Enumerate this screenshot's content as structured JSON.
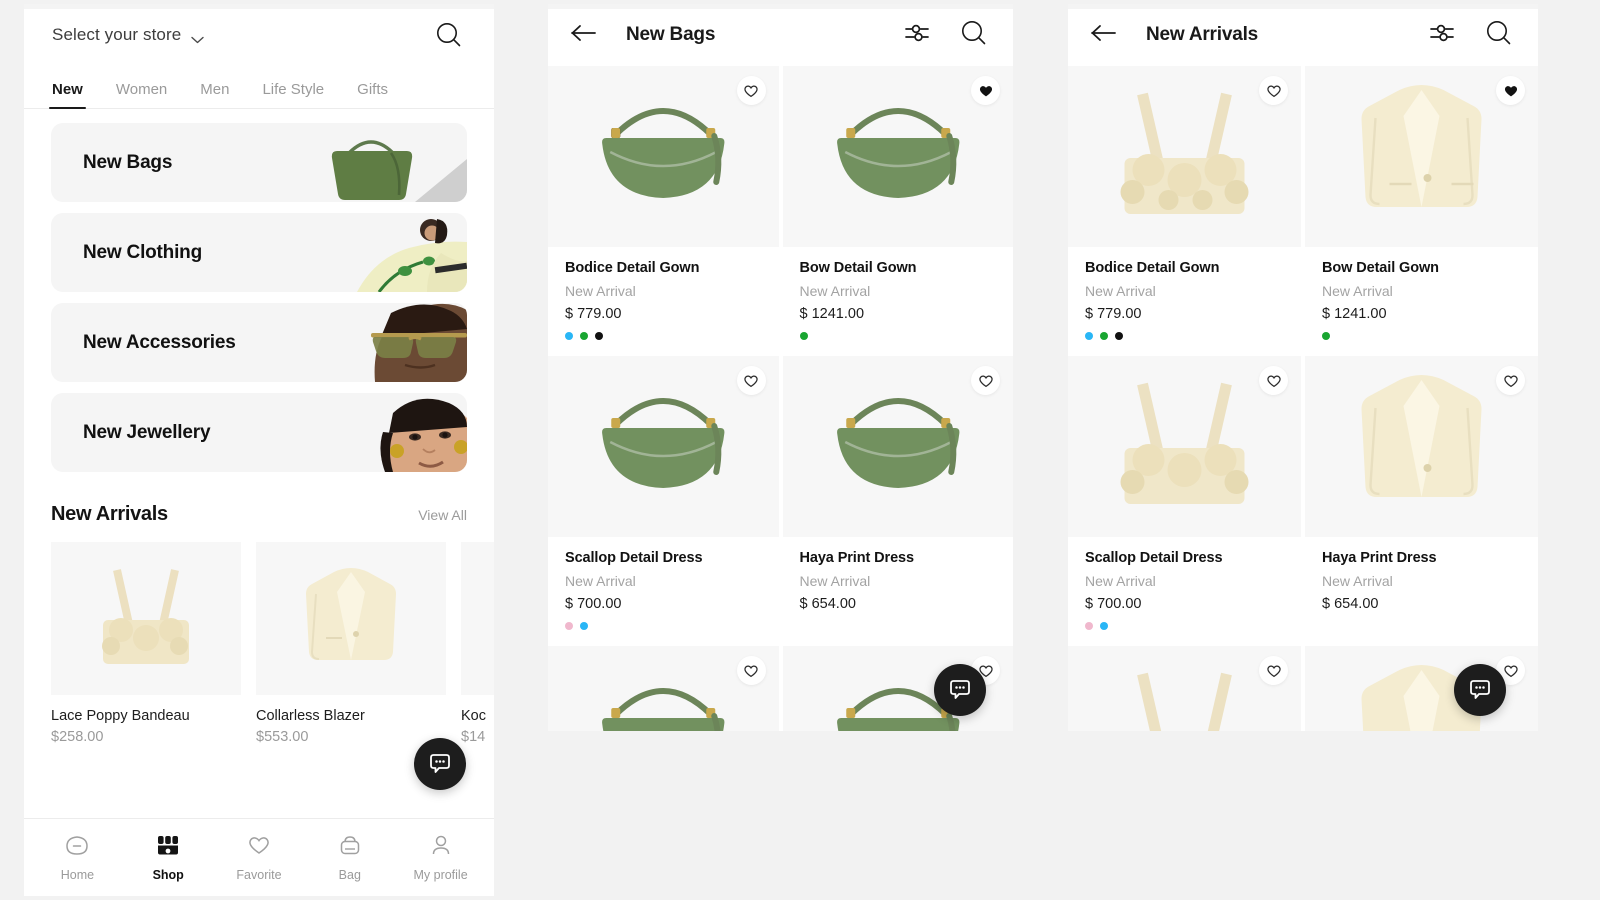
{
  "colors": {
    "accent_black": "#1a1a1a",
    "muted_text": "#9a9a9a",
    "panel_bg": "#ffffff",
    "page_bg": "#f2f2f2",
    "card_bg": "#f5f5f5",
    "swatch_blue": "#29b6f6",
    "swatch_green": "#19a531",
    "swatch_black": "#111111",
    "swatch_pink": "#f0b8cd",
    "bag_green": "#6f8a5e",
    "cream": "#f2ebd3"
  },
  "home": {
    "store_selector": {
      "label": "Select your store",
      "chevron_icon": "chevron-down-icon"
    },
    "search_icon": "search-icon",
    "tabs": [
      {
        "label": "New",
        "active": true
      },
      {
        "label": "Women",
        "active": false
      },
      {
        "label": "Men",
        "active": false
      },
      {
        "label": "Life Style",
        "active": false
      },
      {
        "label": "Gifts",
        "active": false
      }
    ],
    "categories": [
      {
        "label": "New Bags",
        "art": "olive-handbag"
      },
      {
        "label": "New Clothing",
        "art": "woman-print-dress"
      },
      {
        "label": "New Accessories",
        "art": "man-sunglasses"
      },
      {
        "label": "New Jewellery",
        "art": "woman-earring"
      }
    ],
    "new_arrivals": {
      "title": "New Arrivals",
      "view_all": "View All",
      "items": [
        {
          "name": "Lace Poppy Bandeau",
          "price": "$258.00",
          "art": "cream-bandeau"
        },
        {
          "name": "Collarless Blazer",
          "price": "$553.00",
          "art": "cream-blazer"
        },
        {
          "name": "Koc",
          "price": "$14",
          "art": "cream-item",
          "truncated": true
        }
      ]
    },
    "bottom_nav": [
      {
        "label": "Home",
        "icon": "home-icon",
        "active": false
      },
      {
        "label": "Shop",
        "icon": "shop-icon",
        "active": true
      },
      {
        "label": "Favorite",
        "icon": "heart-icon",
        "active": false
      },
      {
        "label": "Bag",
        "icon": "bag-icon",
        "active": false
      },
      {
        "label": "My profile",
        "icon": "person-icon",
        "active": false
      }
    ],
    "chat_fab": "chat-bubble-icon"
  },
  "bags_screen": {
    "back_icon": "arrow-left-icon",
    "title": "New Bags",
    "filter_icon": "filter-sliders-icon",
    "search_icon": "search-icon",
    "chat_fab": "chat-bubble-icon",
    "products": [
      {
        "name": "Bodice Detail Gown",
        "subtitle": "New Arrival",
        "price": "$ 779.00",
        "favorite": false,
        "art": "green-crescent-bag",
        "swatches": [
          "#29b6f6",
          "#19a531",
          "#111111"
        ]
      },
      {
        "name": "Bow Detail Gown",
        "subtitle": "New Arrival",
        "price": "$ 1241.00",
        "favorite": true,
        "art": "green-crescent-bag",
        "swatches": [
          "#19a531"
        ]
      },
      {
        "name": "Scallop Detail Dress",
        "subtitle": "New Arrival",
        "price": "$ 700.00",
        "favorite": false,
        "art": "green-crescent-bag",
        "swatches": [
          "#f0b8cd",
          "#29b6f6"
        ]
      },
      {
        "name": "Haya Print Dress",
        "subtitle": "New Arrival",
        "price": "$ 654.00",
        "favorite": false,
        "art": "green-crescent-bag",
        "swatches": []
      }
    ]
  },
  "new_arrivals_screen": {
    "back_icon": "arrow-left-icon",
    "title": "New Arrivals",
    "filter_icon": "filter-sliders-icon",
    "search_icon": "search-icon",
    "chat_fab": "chat-bubble-icon",
    "products": [
      {
        "name": "Bodice Detail Gown",
        "subtitle": "New Arrival",
        "price": "$ 779.00",
        "favorite": false,
        "art": "cream-bandeau",
        "swatches": [
          "#29b6f6",
          "#19a531",
          "#111111"
        ]
      },
      {
        "name": "Bow Detail Gown",
        "subtitle": "New Arrival",
        "price": "$ 1241.00",
        "favorite": true,
        "art": "cream-blazer",
        "swatches": [
          "#19a531"
        ]
      },
      {
        "name": "Scallop Detail Dress",
        "subtitle": "New Arrival",
        "price": "$ 700.00",
        "favorite": false,
        "art": "cream-bandeau",
        "swatches": [
          "#f0b8cd",
          "#29b6f6"
        ]
      },
      {
        "name": "Haya Print Dress",
        "subtitle": "New Arrival",
        "price": "$ 654.00",
        "favorite": false,
        "art": "cream-blazer",
        "swatches": []
      }
    ]
  }
}
